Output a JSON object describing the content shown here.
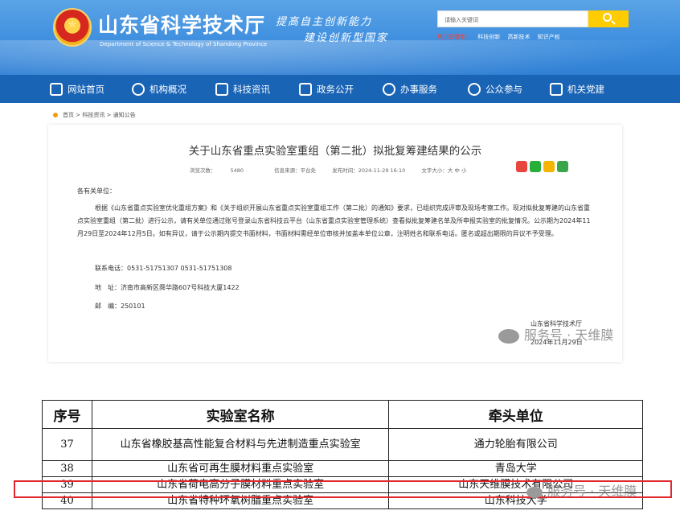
{
  "header": {
    "site_title": "山东省科学技术厅",
    "site_subtitle": "Department of Science & Technology of Shandong Province",
    "slogan_line1": "提高自主创新能力",
    "slogan_line2": "建设创新型国家",
    "search_placeholder": "请输入关键词",
    "hot_label": "热门关键字：",
    "hot_keywords": [
      "科技创新",
      "高新技术",
      "知识产权"
    ]
  },
  "nav": {
    "items": [
      {
        "label": "网站首页",
        "icon": "home-icon"
      },
      {
        "label": "机构概况",
        "icon": "gear-icon"
      },
      {
        "label": "科技资讯",
        "icon": "news-icon"
      },
      {
        "label": "政务公开",
        "icon": "layers-icon"
      },
      {
        "label": "办事服务",
        "icon": "user-icon"
      },
      {
        "label": "公众参与",
        "icon": "people-icon"
      },
      {
        "label": "机关党建",
        "icon": "flag-icon"
      }
    ]
  },
  "breadcrumb": "首页 > 科技资讯 > 通知公告",
  "article": {
    "title": "关于山东省重点实验室重组（第二批）拟批复筹建结果的公示",
    "views_label": "浏览次数：",
    "views": "5480",
    "source": "信息来源：平台处",
    "date": "发布时间：2024-11-29 16:10",
    "font_size": "文字大小：大 中 小",
    "greeting": "各有关单位：",
    "body": "根据《山东省重点实验室优化重组方案》和《关于组织开展山东省重点实验室重组工作（第二批）的通知》要求，已组织完成评审及现场考察工作。现对拟批复筹建的山东省重点实验室重组（第二批）进行公示，请有关单位通过账号登录山东省科技云平台（山东省重点实验室管理系统）查看拟批复筹建名单及所申报实验室的批复情况。公示期为2024年11月29日至2024年12月5日。如有异议，请于公示期内提交书面材料，书面材料需经单位审核并加盖本单位公章，注明姓名和联系电话。匿名或超出期限的异议不予受理。",
    "phone": "联系电话：0531-51751307 0531-51751308",
    "address": "地　址：济南市高新区舜华路607号科技大厦1422",
    "postcode": "邮　编：250101",
    "sign_org": "山东省科学技术厅",
    "sign_date": "2024年11月29日"
  },
  "watermark": "服务号 · 天维膜",
  "table": {
    "headers": [
      "序号",
      "实验室名称",
      "牵头单位"
    ],
    "rows": [
      {
        "no": "37",
        "name": "山东省橡胶基高性能复合材料与先进制造重点实验室",
        "lead": "通力轮胎有限公司"
      },
      {
        "no": "38",
        "name": "山东省可再生膜材料重点实验室",
        "lead": "青岛大学"
      },
      {
        "no": "39",
        "name": "山东省荷电高分子膜材料重点实验室",
        "lead": "山东天维膜技术有限公司"
      },
      {
        "no": "40",
        "name": "山东省特种环氧树脂重点实验室",
        "lead": "山东科技大学"
      }
    ]
  },
  "colors": {
    "header_blue": "#3f8fdf",
    "nav_blue": "#1a64b6",
    "search_yellow": "#ffcc00",
    "highlight_red": "#e0282e"
  }
}
